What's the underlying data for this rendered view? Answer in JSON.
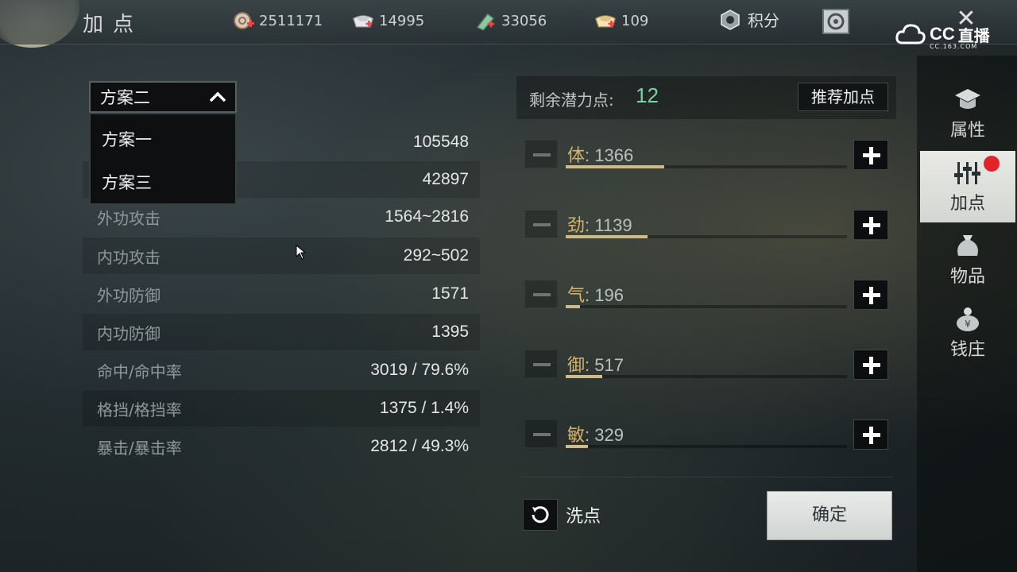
{
  "header": {
    "title": "加点",
    "currencies": [
      {
        "icon": "coin-plus-icon",
        "value": "2511171"
      },
      {
        "icon": "silver-ingot-plus-icon",
        "value": "14995"
      },
      {
        "icon": "jade-plus-icon",
        "value": "33056"
      },
      {
        "icon": "gold-ingot-plus-icon",
        "value": "109"
      }
    ],
    "score_label": "积分",
    "watermark": {
      "brand": "CC",
      "text": "直播",
      "sub": "CC.163.COM"
    }
  },
  "plan_selector": {
    "selected": "方案二",
    "options": [
      "方案一",
      "方案三"
    ]
  },
  "stats": [
    {
      "label": "",
      "value": "105548"
    },
    {
      "label": "",
      "value": "42897"
    },
    {
      "label": "外功攻击",
      "value": "1564~2816"
    },
    {
      "label": "内功攻击",
      "value": "292~502"
    },
    {
      "label": "外功防御",
      "value": "1571"
    },
    {
      "label": "内功防御",
      "value": "1395"
    },
    {
      "label": "命中/命中率",
      "value": "3019 / 79.6%"
    },
    {
      "label": "格挡/格挡率",
      "value": "1375 / 1.4%"
    },
    {
      "label": "暴击/暴击率",
      "value": "2812 / 49.3%"
    }
  ],
  "potential": {
    "label": "剩余潜力点:",
    "value": "12"
  },
  "recommend_label": "推荐加点",
  "attributes": [
    {
      "name": "体",
      "value": "1366",
      "fill": 0.35
    },
    {
      "name": "劲",
      "value": "1139",
      "fill": 0.29
    },
    {
      "name": "气",
      "value": "196",
      "fill": 0.05
    },
    {
      "name": "御",
      "value": "517",
      "fill": 0.13
    },
    {
      "name": "敏",
      "value": "329",
      "fill": 0.08
    }
  ],
  "wash_label": "洗点",
  "confirm_label": "确定",
  "tabs": [
    {
      "label": "属性",
      "icon": "scholar-hat-icon",
      "active": false
    },
    {
      "label": "加点",
      "icon": "sliders-icon",
      "active": true
    },
    {
      "label": "物品",
      "icon": "bag-icon",
      "active": false
    },
    {
      "label": "钱庄",
      "icon": "money-bag-icon",
      "active": false
    }
  ],
  "colors": {
    "potential_value": "#7fd1a6",
    "attr_name": "#d6b36a",
    "bar_fill": "#cdbb8c",
    "badge": "#e0242a"
  }
}
